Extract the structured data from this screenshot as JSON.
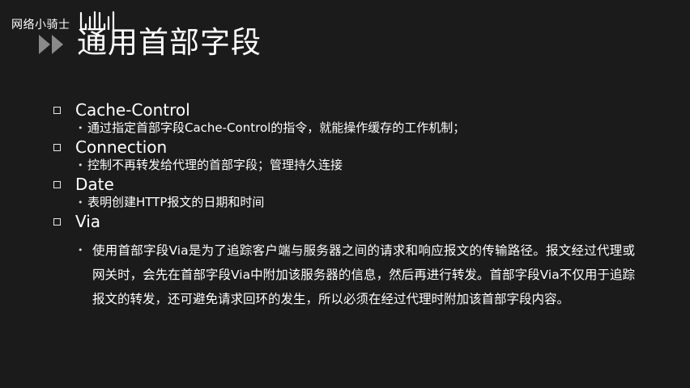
{
  "watermark": {
    "channel_name": "网络小骑士",
    "logo_icon": "bilibili-logo-icon"
  },
  "title": {
    "text": "通用首部字段",
    "arrows_icon": "double-chevron-right-icon"
  },
  "items": [
    {
      "name": "Cache-Control",
      "desc": "通过指定首部字段Cache-Control的指令，就能操作缓存的工作机制；"
    },
    {
      "name": "Connection",
      "desc": "控制不再转发给代理的首部字段；管理持久连接"
    },
    {
      "name": "Date",
      "desc": "表明创建HTTP报文的日期和时间"
    },
    {
      "name": "Via",
      "desc": "使用首部字段Via是为了追踪客户端与服务器之间的请求和响应报文的传输路径。报文经过代理或网关时，会先在首部字段Via中附加该服务器的信息，然后再进行转发。首部字段Via不仅用于追踪报文的转发，还可避免请求回环的发生，所以必须在经过代理时附加该首部字段内容。"
    }
  ],
  "colors": {
    "background": "#1b1b1b",
    "text": "#ffffff",
    "arrow": "#8a8a8a"
  }
}
